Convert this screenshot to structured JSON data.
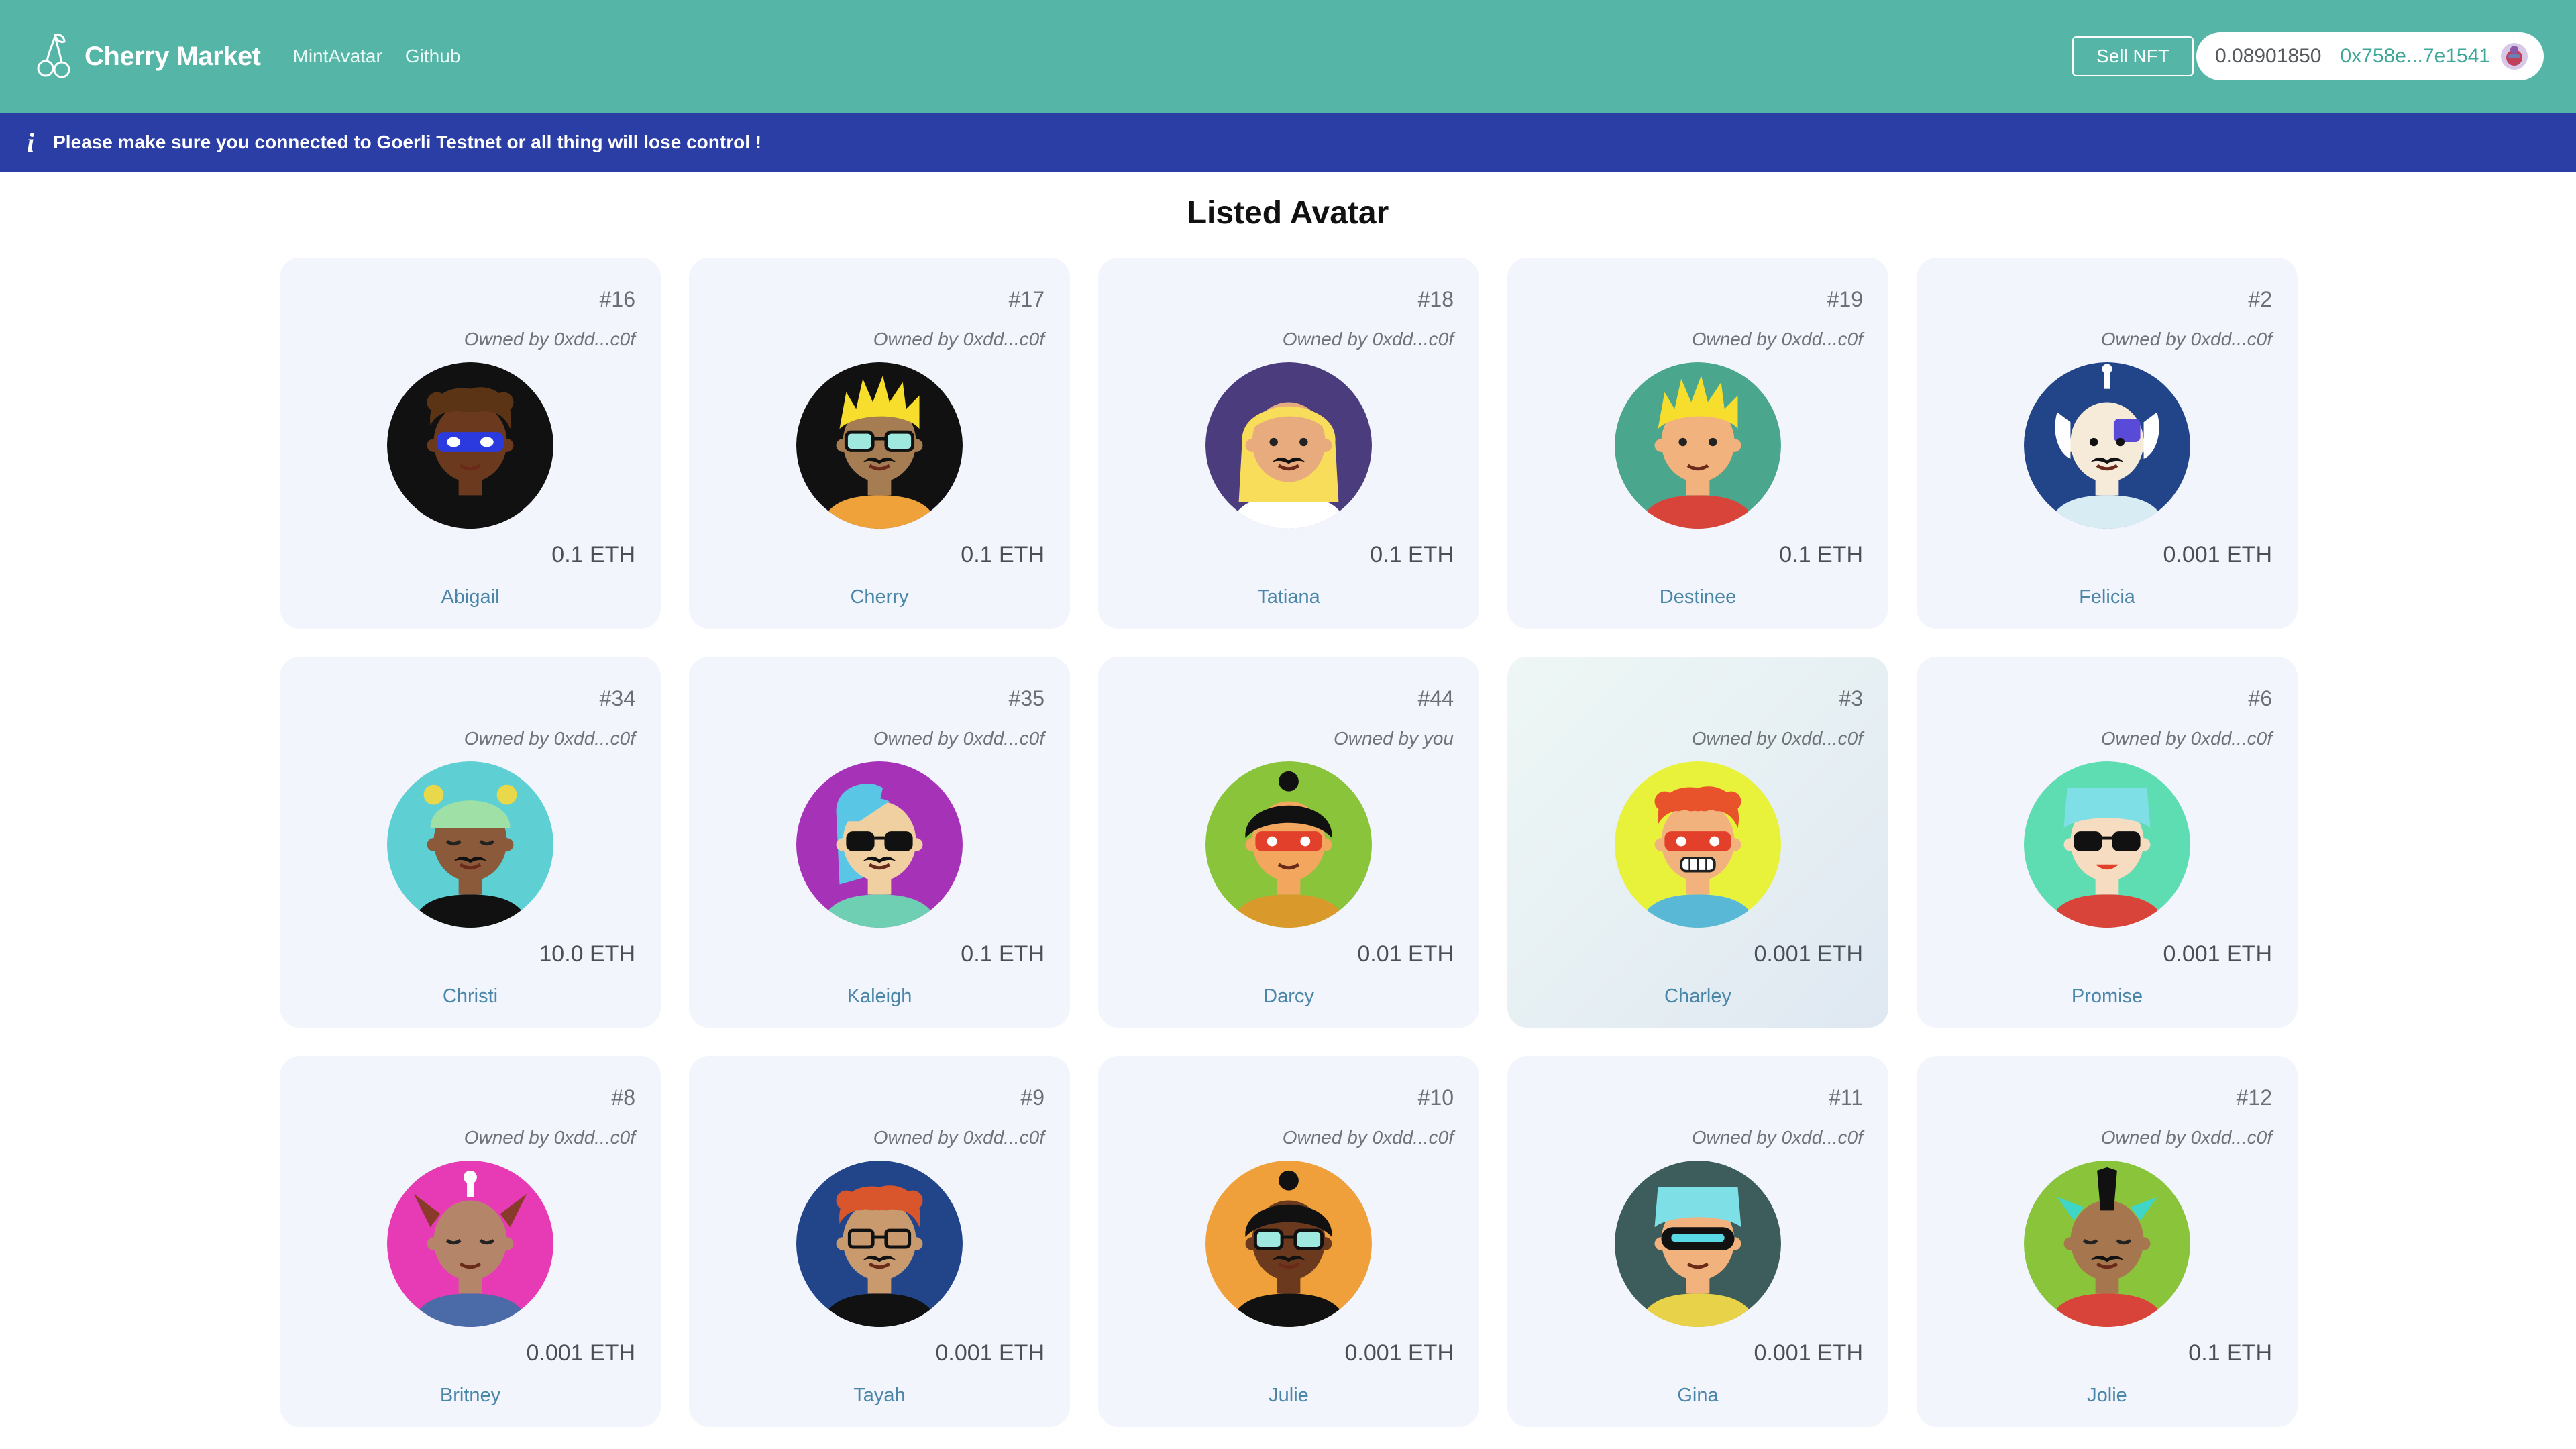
{
  "brand": {
    "name": "Cherry Market"
  },
  "nav": {
    "items": [
      "MintAvatar",
      "Github"
    ]
  },
  "header": {
    "sell_label": "Sell NFT",
    "balance": "0.08901850",
    "address": "0x758e...7e1541"
  },
  "notice": {
    "icon": "i",
    "text": "Please make sure you connected to Goerli Testnet or all thing will lose control !"
  },
  "page": {
    "title": "Listed Avatar"
  },
  "colors": {
    "header_bg": "#55b5a6",
    "notice_bg": "#2b3ea5",
    "card_bg": "#f2f5fc",
    "name_link": "#4a86a8"
  },
  "cards": [
    {
      "id": "#16",
      "owner": "Owned by 0xdd...c0f",
      "price": "0.1 ETH",
      "name": "Abigail",
      "avatar": {
        "bg": "#111111",
        "skin": "#6b3a1e",
        "hair": "#5b3415",
        "hair_style": "curly",
        "eyes": "blue-mask",
        "mustache": false,
        "shirt": "#111111"
      }
    },
    {
      "id": "#17",
      "owner": "Owned by 0xdd...c0f",
      "price": "0.1 ETH",
      "name": "Cherry",
      "avatar": {
        "bg": "#111111",
        "skin": "#a67c52",
        "hair": "#f7dd2c",
        "hair_style": "spiky",
        "eyes": "teal-glasses",
        "mustache": true,
        "shirt": "#f0a23a"
      }
    },
    {
      "id": "#18",
      "owner": "Owned by 0xdd...c0f",
      "price": "0.1 ETH",
      "name": "Tatiana",
      "avatar": {
        "bg": "#4b3c7e",
        "skin": "#e8ab7d",
        "hair": "#f7dd5a",
        "hair_style": "long",
        "eyes": "plain",
        "mustache": true,
        "shirt": "#ffffff"
      }
    },
    {
      "id": "#19",
      "owner": "Owned by 0xdd...c0f",
      "price": "0.1 ETH",
      "name": "Destinee",
      "avatar": {
        "bg": "#4ba68e",
        "skin": "#f2b27e",
        "hair": "#f7dd2c",
        "hair_style": "spiky",
        "eyes": "plain",
        "mustache": false,
        "shirt": "#d9443a"
      }
    },
    {
      "id": "#2",
      "owner": "Owned by 0xdd...c0f",
      "price": "0.001 ETH",
      "name": "Felicia",
      "avatar": {
        "bg": "#22458a",
        "skin": "#f6ead8",
        "hair": "#5a4ad8",
        "hair_style": "robot",
        "eyes": "robot",
        "mustache": true,
        "shirt": "#d8ecf4"
      }
    },
    {
      "id": "#34",
      "owner": "Owned by 0xdd...c0f",
      "price": "10.0 ETH",
      "name": "Christi",
      "avatar": {
        "bg": "#5ecfd3",
        "skin": "#8a5a3a",
        "hair": "#9ee0a5",
        "hair_style": "beanie",
        "eyes": "closed",
        "mustache": true,
        "shirt": "#111111"
      }
    },
    {
      "id": "#35",
      "owner": "Owned by 0xdd...c0f",
      "price": "0.1 ETH",
      "name": "Kaleigh",
      "avatar": {
        "bg": "#a632b8",
        "skin": "#f0cfa0",
        "hair": "#59c6e6",
        "hair_style": "side",
        "eyes": "sunglasses",
        "mustache": true,
        "shirt": "#6fcfb3"
      }
    },
    {
      "id": "#44",
      "owner": "Owned by you",
      "price": "0.01 ETH",
      "name": "Darcy",
      "avatar": {
        "bg": "#8ac43b",
        "skin": "#f2a65e",
        "hair": "#111111",
        "hair_style": "bun",
        "eyes": "red-mask",
        "mustache": false,
        "shirt": "#d99a2b"
      }
    },
    {
      "id": "#3",
      "owner": "Owned by 0xdd...c0f",
      "price": "0.001 ETH",
      "name": "Charley",
      "highlight": true,
      "avatar": {
        "bg": "#e8f23a",
        "skin": "#f2b27e",
        "hair": "#e8532b",
        "hair_style": "curly",
        "eyes": "red-mask",
        "mustache": false,
        "grin": true,
        "shirt": "#59b8d6"
      }
    },
    {
      "id": "#6",
      "owner": "Owned by 0xdd...c0f",
      "price": "0.001 ETH",
      "name": "Promise",
      "avatar": {
        "bg": "#5edcb2",
        "skin": "#f6dcc0",
        "hair": "#7ee0e6",
        "hair_style": "flat",
        "eyes": "sunglasses",
        "mustache": false,
        "lips": true,
        "shirt": "#d9443a"
      }
    },
    {
      "id": "#8",
      "owner": "Owned by 0xdd...c0f",
      "price": "0.001 ETH",
      "name": "Britney",
      "avatar": {
        "bg": "#e63bb4",
        "skin": "#b5856a",
        "hair": "#8a3a2a",
        "hair_style": "horns",
        "eyes": "closed",
        "mustache": false,
        "shirt": "#4b6aa8"
      }
    },
    {
      "id": "#9",
      "owner": "Owned by 0xdd...c0f",
      "price": "0.001 ETH",
      "name": "Tayah",
      "avatar": {
        "bg": "#22458a",
        "skin": "#c99a6e",
        "hair": "#d9552b",
        "hair_style": "curly",
        "eyes": "glasses",
        "mustache": true,
        "shirt": "#111111"
      }
    },
    {
      "id": "#10",
      "owner": "Owned by 0xdd...c0f",
      "price": "0.001 ETH",
      "name": "Julie",
      "avatar": {
        "bg": "#f0a03a",
        "skin": "#6b3a1e",
        "hair": "#111111",
        "hair_style": "bun",
        "eyes": "teal-glasses",
        "mustache": true,
        "shirt": "#111111"
      }
    },
    {
      "id": "#11",
      "owner": "Owned by 0xdd...c0f",
      "price": "0.001 ETH",
      "name": "Gina",
      "avatar": {
        "bg": "#3d5c5c",
        "skin": "#f2b27e",
        "hair": "#7ee0e6",
        "hair_style": "flat",
        "eyes": "visor",
        "mustache": false,
        "shirt": "#e8d24a"
      }
    },
    {
      "id": "#12",
      "owner": "Owned by 0xdd...c0f",
      "price": "0.1 ETH",
      "name": "Jolie",
      "avatar": {
        "bg": "#8ac43b",
        "skin": "#a6764e",
        "hair": "#3fd6c8",
        "hair_style": "mohawk",
        "eyes": "closed",
        "mustache": true,
        "shirt": "#d9443a"
      }
    }
  ]
}
